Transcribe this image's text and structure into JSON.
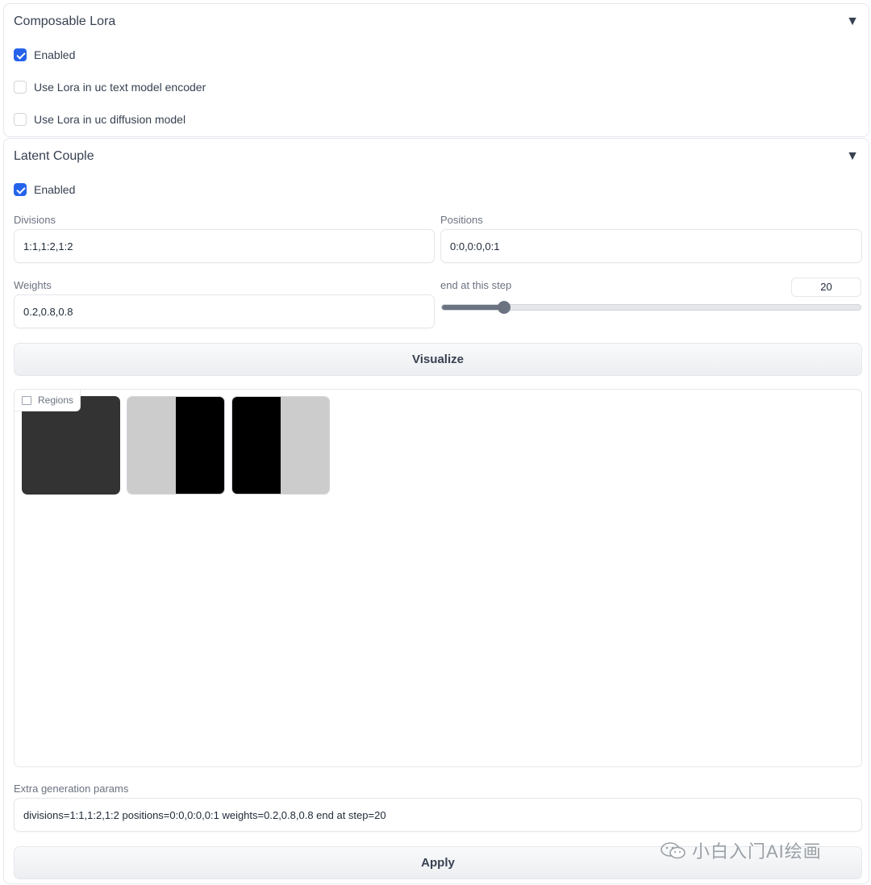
{
  "composable_lora": {
    "title": "Composable Lora",
    "enabled_label": "Enabled",
    "enabled": true,
    "uc_text_label": "Use Lora in uc text model encoder",
    "uc_text": false,
    "uc_diffusion_label": "Use Lora in uc diffusion model",
    "uc_diffusion": false
  },
  "latent_couple": {
    "title": "Latent Couple",
    "enabled_label": "Enabled",
    "enabled": true,
    "divisions_label": "Divisions",
    "divisions_value": "1:1,1:2,1:2",
    "positions_label": "Positions",
    "positions_value": "0:0,0:0,0:1",
    "weights_label": "Weights",
    "weights_value": "0.2,0.8,0.8",
    "end_step_label": "end at this step",
    "end_step_value": "20",
    "end_step_fraction": 0.15,
    "visualize_label": "Visualize",
    "regions_label": "Regions",
    "regions": [
      {
        "left_color": "#333333",
        "right_color": "#333333"
      },
      {
        "left_color": "#cccccc",
        "right_color": "#000000"
      },
      {
        "left_color": "#000000",
        "right_color": "#cccccc"
      }
    ],
    "extra_params_label": "Extra generation params",
    "extra_params_value": "divisions=1:1,1:2,1:2 positions=0:0,0:0,0:1 weights=0.2,0.8,0.8 end at step=20",
    "apply_label": "Apply"
  },
  "icons": {
    "collapse": "triangle-down-icon",
    "check": "check-icon",
    "image": "image-icon"
  },
  "watermark": {
    "text": "小白入门AI绘画",
    "icon": "wechat-icon"
  },
  "colors": {
    "accent": "#2563eb",
    "slider": "#6b7280"
  }
}
